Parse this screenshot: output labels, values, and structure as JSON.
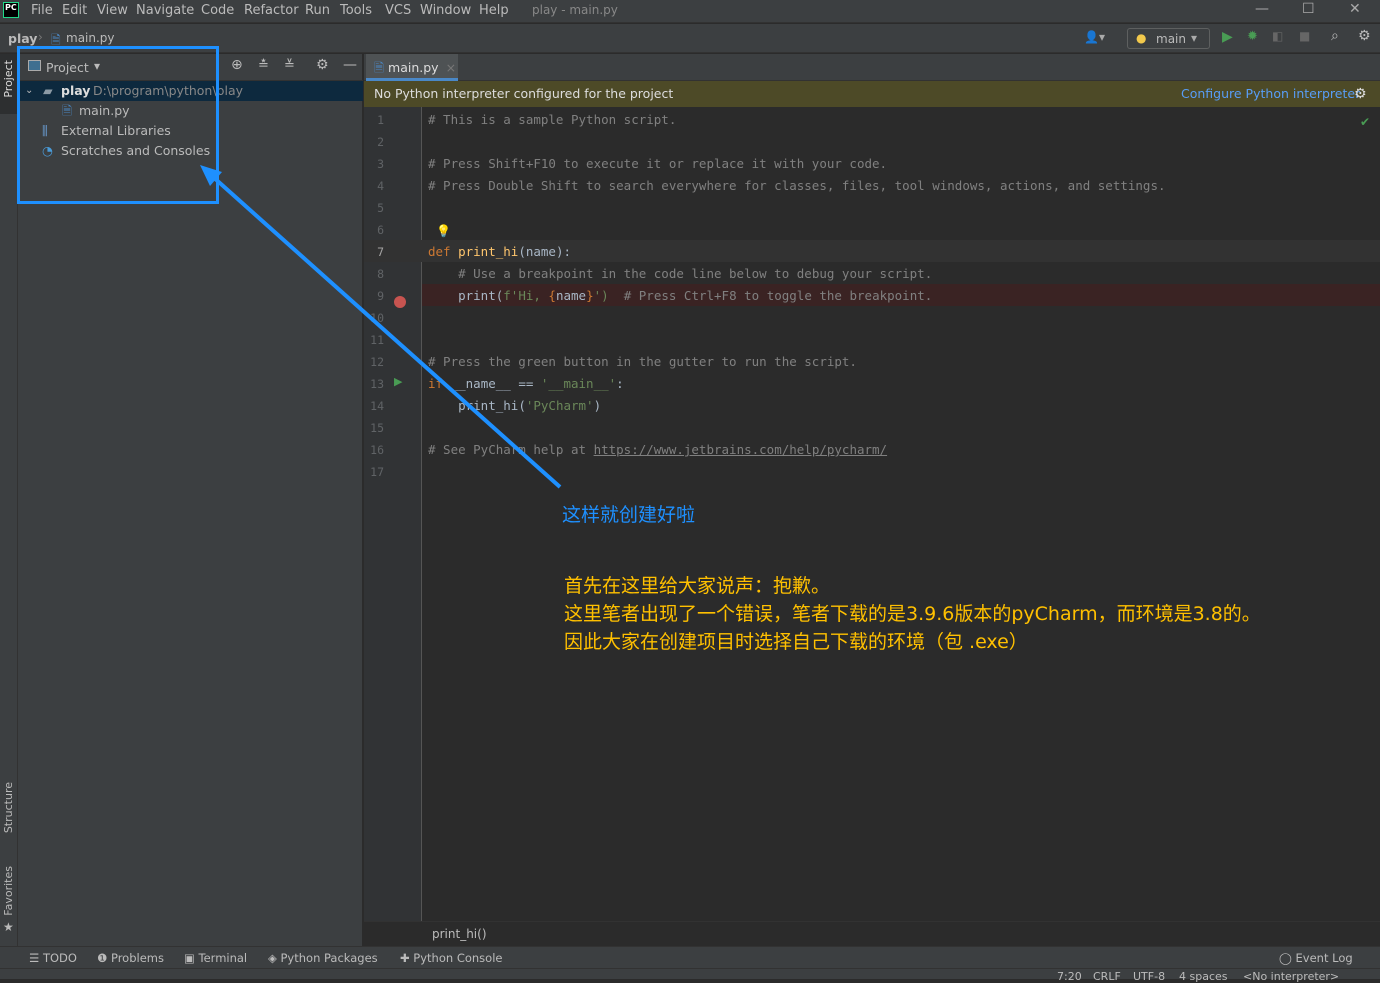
{
  "window": {
    "title": "play - main.py",
    "logo": "PC"
  },
  "menu": [
    "File",
    "Edit",
    "View",
    "Navigate",
    "Code",
    "Refactor",
    "Run",
    "Tools",
    "VCS",
    "Window",
    "Help"
  ],
  "nav": {
    "project": "play",
    "file": "main.py",
    "run_config": "main"
  },
  "side_labels": {
    "project": "Project",
    "structure": "Structure",
    "favorites": "Favorites"
  },
  "project_panel": {
    "title": "Project",
    "root": "play",
    "root_path": "D:\\program\\python\\play",
    "items": [
      "main.py",
      "External Libraries",
      "Scratches and Consoles"
    ]
  },
  "editor": {
    "tab": "main.py",
    "banner": "No Python interpreter configured for the project",
    "banner_link": "Configure Python interpreter",
    "breadcrumb": "print_hi()"
  },
  "code": {
    "l1": "# This is a sample Python script.",
    "l3": "# Press Shift+F10 to execute it or replace it with your code.",
    "l4": "# Press Double Shift to search everywhere for classes, files, tool windows, actions, and settings.",
    "l7a": "def",
    "l7b": "print_hi",
    "l7c": "(name):",
    "l8": "# Use a breakpoint in the code line below to debug your script.",
    "l9a": "print(",
    "l9b": "f'Hi, ",
    "l9c": "{",
    "l9d": "name",
    "l9e": "}",
    "l9f": "')",
    "l9g": "# Press Ctrl+F8 to toggle the breakpoint.",
    "l12": "# Press the green button in the gutter to run the script.",
    "l13a": "if",
    "l13b": " __name__ == ",
    "l13c": "'__main__'",
    "l13d": ":",
    "l14a": "print_hi(",
    "l14b": "'PyCharm'",
    "l14c": ")",
    "l16a": "# See PyCharm help at ",
    "l16b": "https://www.jetbrains.com/help/pycharm/"
  },
  "line_numbers": [
    "1",
    "2",
    "3",
    "4",
    "5",
    "6",
    "7",
    "8",
    "9",
    "10",
    "11",
    "12",
    "13",
    "14",
    "15",
    "16",
    "17"
  ],
  "tool_windows": [
    "TODO",
    "Problems",
    "Terminal",
    "Python Packages",
    "Python Console"
  ],
  "event_log": "Event Log",
  "status": {
    "position": "7:20",
    "line_sep": "CRLF",
    "encoding": "UTF-8",
    "indent": "4 spaces",
    "interpreter": "<No interpreter>"
  },
  "annotations": {
    "blue_note": "这样就创建好啦",
    "yellow_lines": [
      "首先在这里给大家说声：抱歉。",
      "这里笔者出现了一个错误，笔者下载的是3.9.6版本的pyCharm，而环境是3.8的。",
      "因此大家在创建项目时选择自己下载的环境（包    .exe）"
    ],
    "colors": {
      "blue": "#1e90ff",
      "yellow": "#ffc000"
    }
  }
}
